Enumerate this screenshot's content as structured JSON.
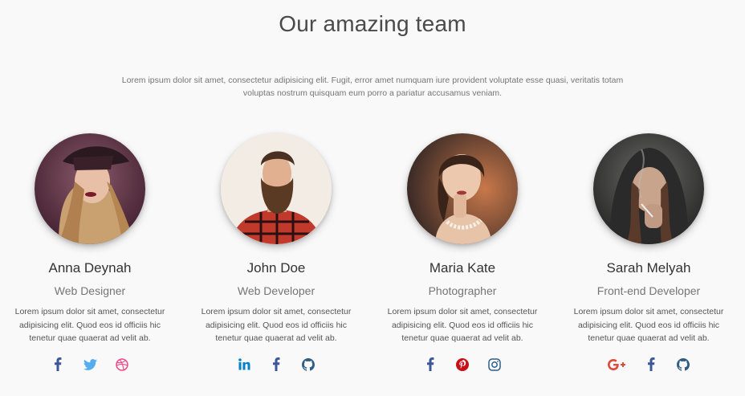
{
  "section": {
    "title": "Our amazing team",
    "intro": "Lorem ipsum dolor sit amet, consectetur adipisicing elit. Fugit, error amet numquam iure provident voluptate esse quasi, veritatis totam voluptas nostrum quisquam eum porro a pariatur accusamus veniam."
  },
  "members": [
    {
      "name": "Anna Deynah",
      "role": "Web Designer",
      "description": "Lorem ipsum dolor sit amet, consectetur adipisicing elit. Quod eos id officiis hic tenetur quae quaerat ad velit ab.",
      "socials": [
        "facebook-icon",
        "twitter-icon",
        "dribbble-icon"
      ]
    },
    {
      "name": "John Doe",
      "role": "Web Developer",
      "description": "Lorem ipsum dolor sit amet, consectetur adipisicing elit. Quod eos id officiis hic tenetur quae quaerat ad velit ab.",
      "socials": [
        "linkedin-icon",
        "facebook-icon",
        "github-icon"
      ]
    },
    {
      "name": "Maria Kate",
      "role": "Photographer",
      "description": "Lorem ipsum dolor sit amet, consectetur adipisicing elit. Quod eos id officiis hic tenetur quae quaerat ad velit ab.",
      "socials": [
        "facebook-icon",
        "pinterest-icon",
        "instagram-icon"
      ]
    },
    {
      "name": "Sarah Melyah",
      "role": "Front-end Developer",
      "description": "Lorem ipsum dolor sit amet, consectetur adipisicing elit. Quod eos id officiis hic tenetur quae quaerat ad velit ab.",
      "socials": [
        "google-plus-icon",
        "facebook-icon",
        "github-icon"
      ]
    }
  ],
  "colors": {
    "facebook": "#3b5998",
    "twitter": "#55acee",
    "dribbble": "#ec4a89",
    "linkedin": "#0082ca",
    "github": "#333333",
    "pinterest": "#c61118",
    "instagram": "#2e5e86",
    "google_plus": "#dd4b39"
  }
}
